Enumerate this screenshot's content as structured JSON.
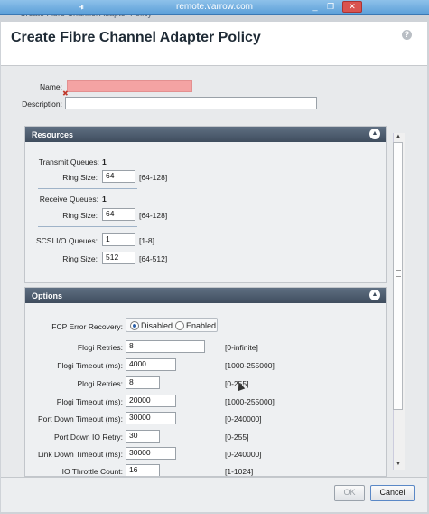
{
  "remote": {
    "title": "remote.varrow.com"
  },
  "dialog": {
    "window_title": "Create Fibre Channel Adapter Policy",
    "heading": "Create Fibre Channel Adapter Policy",
    "help": "?"
  },
  "form": {
    "name_label": "Name:",
    "name_value": "",
    "description_label": "Description:",
    "description_value": ""
  },
  "resources": {
    "title": "Resources",
    "transmit_queues_label": "Transmit Queues:",
    "transmit_queues_value": "1",
    "transmit_ring_label": "Ring Size:",
    "transmit_ring_value": "64",
    "transmit_ring_range": "[64-128]",
    "receive_queues_label": "Receive Queues:",
    "receive_queues_value": "1",
    "receive_ring_label": "Ring Size:",
    "receive_ring_value": "64",
    "receive_ring_range": "[64-128]",
    "scsi_queues_label": "SCSI I/O Queues:",
    "scsi_queues_value": "1",
    "scsi_queues_range": "[1-8]",
    "scsi_ring_label": "Ring Size:",
    "scsi_ring_value": "512",
    "scsi_ring_range": "[64-512]"
  },
  "options": {
    "title": "Options",
    "fcp_label": "FCP Error Recovery:",
    "fcp_disabled": "Disabled",
    "fcp_enabled": "Enabled",
    "fields": [
      {
        "label": "Flogi Retries:",
        "value": "8",
        "range": "[0-infinite]"
      },
      {
        "label": "Flogi Timeout (ms):",
        "value": "4000",
        "range": "[1000-255000]"
      },
      {
        "label": "Plogi Retries:",
        "value": "8",
        "range": "[0-255]"
      },
      {
        "label": "Plogi Timeout (ms):",
        "value": "20000",
        "range": "[1000-255000]"
      },
      {
        "label": "Port Down Timeout (ms):",
        "value": "30000",
        "range": "[0-240000]"
      },
      {
        "label": "Port Down IO Retry:",
        "value": "30",
        "range": "[0-255]"
      },
      {
        "label": "Link Down Timeout (ms):",
        "value": "30000",
        "range": "[0-240000]"
      },
      {
        "label": "IO Throttle Count:",
        "value": "16",
        "range": "[1-1024]"
      }
    ]
  },
  "footer": {
    "ok": "OK",
    "cancel": "Cancel"
  },
  "colors": {
    "name_invalid": "#f4a3a3",
    "panel_header": "#4a5869",
    "titlebar": "#5b9fd8"
  }
}
